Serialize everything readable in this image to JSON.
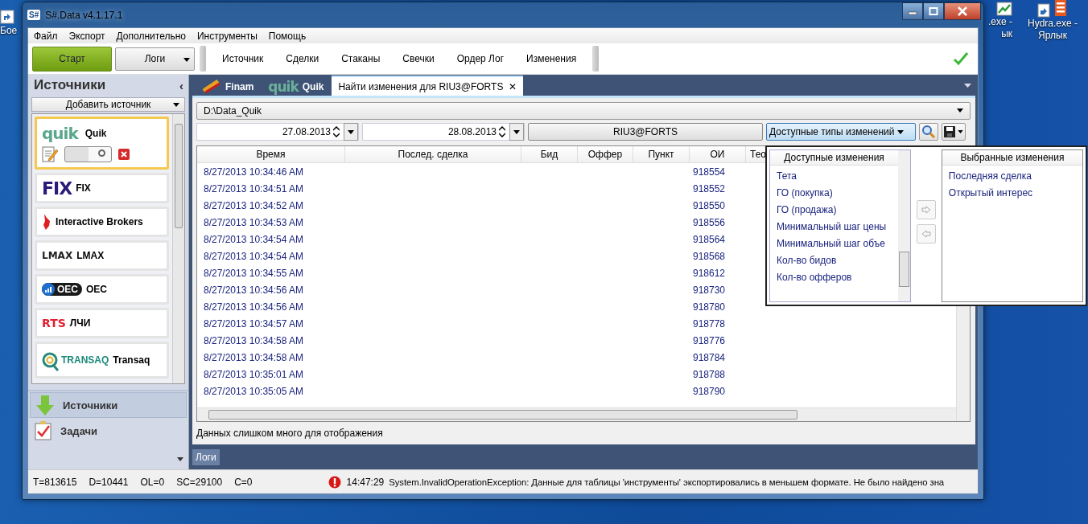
{
  "desktop": {
    "icons": [
      {
        "kind": "shortcut",
        "lines": [
          "Бое"
        ]
      },
      {
        "kind": "chart",
        "lines": [
          ".exe -",
          "ык"
        ]
      },
      {
        "kind": "hydra",
        "lines": [
          "Hydra.exe -",
          "Ярлык"
        ]
      }
    ]
  },
  "window": {
    "logo": "S#",
    "title": "S#.Data v4.1.17.1"
  },
  "menu": [
    "Файл",
    "Экспорт",
    "Дополнительно",
    "Инструменты",
    "Помощь"
  ],
  "toolbar": {
    "start": "Старт",
    "logs": "Логи",
    "items": [
      "Источник",
      "Сделки",
      "Стаканы",
      "Свечки",
      "Ордер Лог",
      "Изменения"
    ],
    "ok": true
  },
  "sidebar": {
    "title": "Источники",
    "collapse": "‹",
    "add": "Добавить источник",
    "sources": [
      {
        "kind": "quik",
        "logo": "quik",
        "label": "Quik",
        "selected": true,
        "on": false
      },
      {
        "kind": "fix",
        "logo": "FIX",
        "label": "FIX",
        "selected": false
      },
      {
        "kind": "ib",
        "label": "Interactive Brokers",
        "selected": false
      },
      {
        "kind": "lmax",
        "logo": "LMAX",
        "label": "LMAX",
        "selected": false
      },
      {
        "kind": "oec",
        "logo": "OEC",
        "label": "OEC",
        "selected": false
      },
      {
        "kind": "rts",
        "logo": "RTS",
        "label": "ЛЧИ",
        "selected": false
      },
      {
        "kind": "transaq",
        "logo": "TRANSAQ",
        "label": "Transaq",
        "selected": false
      }
    ],
    "nav": [
      {
        "kind": "sources",
        "label": "Источники",
        "selected": true
      },
      {
        "kind": "tasks",
        "label": "Задачи",
        "selected": false
      }
    ]
  },
  "tabs": [
    {
      "kind": "finam",
      "label": "Finam",
      "selected": false
    },
    {
      "kind": "quik",
      "logo": "quik",
      "label": "Quik",
      "selected": false
    },
    {
      "kind": "doc",
      "label": "Найти изменения для RIU3@FORTS",
      "close": "✕",
      "selected": true
    }
  ],
  "finder": {
    "path": "D:\\Data_Quik",
    "from": "27.08.2013",
    "to": "28.08.2013",
    "security": "RIU3@FORTS",
    "types": "Доступные типы изменений"
  },
  "table": {
    "columns": [
      "Время",
      "Послед. сделка",
      "Бид",
      "Оффер",
      "Пункт",
      "ОИ",
      "Тео"
    ],
    "rows": [
      {
        "time": "8/27/2013 10:34:46 AM",
        "oi": "918554"
      },
      {
        "time": "8/27/2013 10:34:51 AM",
        "oi": "918552"
      },
      {
        "time": "8/27/2013 10:34:52 AM",
        "oi": "918550"
      },
      {
        "time": "8/27/2013 10:34:53 AM",
        "oi": "918556"
      },
      {
        "time": "8/27/2013 10:34:54 AM",
        "oi": "918564"
      },
      {
        "time": "8/27/2013 10:34:54 AM",
        "oi": "918568"
      },
      {
        "time": "8/27/2013 10:34:55 AM",
        "oi": "918612"
      },
      {
        "time": "8/27/2013 10:34:56 AM",
        "oi": "918730"
      },
      {
        "time": "8/27/2013 10:34:56 AM",
        "oi": "918780"
      },
      {
        "time": "8/27/2013 10:34:57 AM",
        "oi": "918778"
      },
      {
        "time": "8/27/2013 10:34:58 AM",
        "oi": "918776"
      },
      {
        "time": "8/27/2013 10:34:58 AM",
        "oi": "918784"
      },
      {
        "time": "8/27/2013 10:35:01 AM",
        "oi": "918788"
      },
      {
        "time": "8/27/2013 10:35:05 AM",
        "oi": "918790"
      }
    ]
  },
  "message": "Данных слишком много для отображения",
  "log_tab": "Логи",
  "popup": {
    "available_header": "Доступные изменения",
    "available": [
      "Тета",
      "ГО (покупка)",
      "ГО (продажа)",
      "Минимальный шаг цены",
      "Минимальный шаг объе",
      "Кол-во бидов",
      "Кол-во офферов"
    ],
    "selected_header": "Выбранные изменения",
    "selected": [
      "Последняя сделка",
      "Открытый интерес"
    ]
  },
  "status_bar": {
    "counters": [
      "T=813615",
      "D=10441",
      "OL=0",
      "SC=29100",
      "C=0"
    ],
    "error": {
      "time": "14:47:29",
      "text": "System.InvalidOperationException: Данные для таблицы 'инструменты' экспортировались в меньшем формате. Не было найдено зна"
    }
  }
}
